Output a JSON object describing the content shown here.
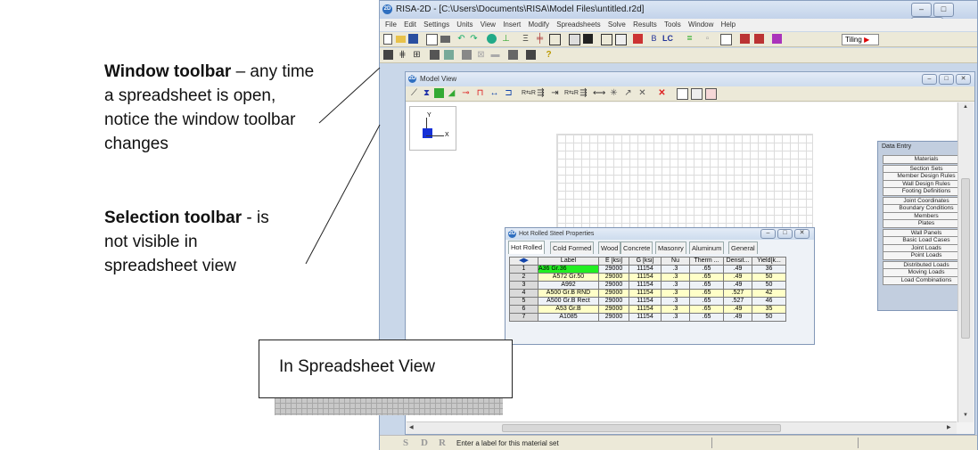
{
  "annotations": {
    "window_toolbar": {
      "bold": "Window toolbar",
      "rest": " – any time a spreadsheet is open, notice the window toolbar changes"
    },
    "selection_toolbar": {
      "bold": "Selection toolbar",
      "rest": " - is not visible in spreadsheet view"
    },
    "callout": "In Spreadsheet View"
  },
  "app": {
    "title": "RISA-2D - [C:\\Users\\Documents\\RISA\\Model Files\\untitled.r2d]",
    "menu": [
      "File",
      "Edit",
      "Settings",
      "Units",
      "View",
      "Insert",
      "Modify",
      "Spreadsheets",
      "Solve",
      "Results",
      "Tools",
      "Window",
      "Help"
    ],
    "tiling_label": "Tiling",
    "window_buttons": [
      "–",
      "□",
      "✕"
    ]
  },
  "model_view": {
    "title": "Model View",
    "axis_y": "Y",
    "axis_x": "X"
  },
  "data_entry": {
    "title": "Data Entry",
    "close": "✕",
    "items": [
      "Materials",
      "Section Sets",
      "Member Design Rules",
      "Wall Design Rules",
      "Footing Definitions",
      "Joint Coordinates",
      "Boundary Conditions",
      "Members",
      "Plates",
      "Wall Panels",
      "Basic Load Cases",
      "Joint Loads",
      "Point Loads",
      "Distributed Loads",
      "Moving Loads",
      "Load Combinations"
    ]
  },
  "spreadsheet": {
    "title": "Hot Rolled Steel Properties",
    "tabs": [
      "Hot Rolled",
      "Cold Formed",
      "Wood",
      "Concrete",
      "Masonry",
      "Aluminum",
      "General"
    ],
    "columns": [
      "Label",
      "E [ksi]",
      "G [ksi]",
      "Nu",
      "Therm ...",
      "Densit...",
      "Yield[k..."
    ],
    "rows": [
      [
        "1",
        "A36 Gr.36",
        "29000",
        "11154",
        ".3",
        ".65",
        ".49",
        "36"
      ],
      [
        "2",
        "A572 Gr.50",
        "29000",
        "11154",
        ".3",
        ".65",
        ".49",
        "50"
      ],
      [
        "3",
        "A992",
        "29000",
        "11154",
        ".3",
        ".65",
        ".49",
        "50"
      ],
      [
        "4",
        "A500 Gr.B RND",
        "29000",
        "11154",
        ".3",
        ".65",
        ".527",
        "42"
      ],
      [
        "5",
        "A500 Gr.B Rect",
        "29000",
        "11154",
        ".3",
        ".65",
        ".527",
        "46"
      ],
      [
        "6",
        "A53 Gr.B",
        "29000",
        "11154",
        ".3",
        ".65",
        ".49",
        "35"
      ],
      [
        "7",
        "A1085",
        "29000",
        "11154",
        ".3",
        ".65",
        ".49",
        "50"
      ]
    ]
  },
  "status": {
    "letters": [
      "S",
      "D",
      "R"
    ],
    "message": "Enter a label for this material set"
  },
  "colors": {
    "selected_cell": "#22ee22",
    "alt_row": "#ffffc8",
    "accent": "#2f6fc0"
  }
}
